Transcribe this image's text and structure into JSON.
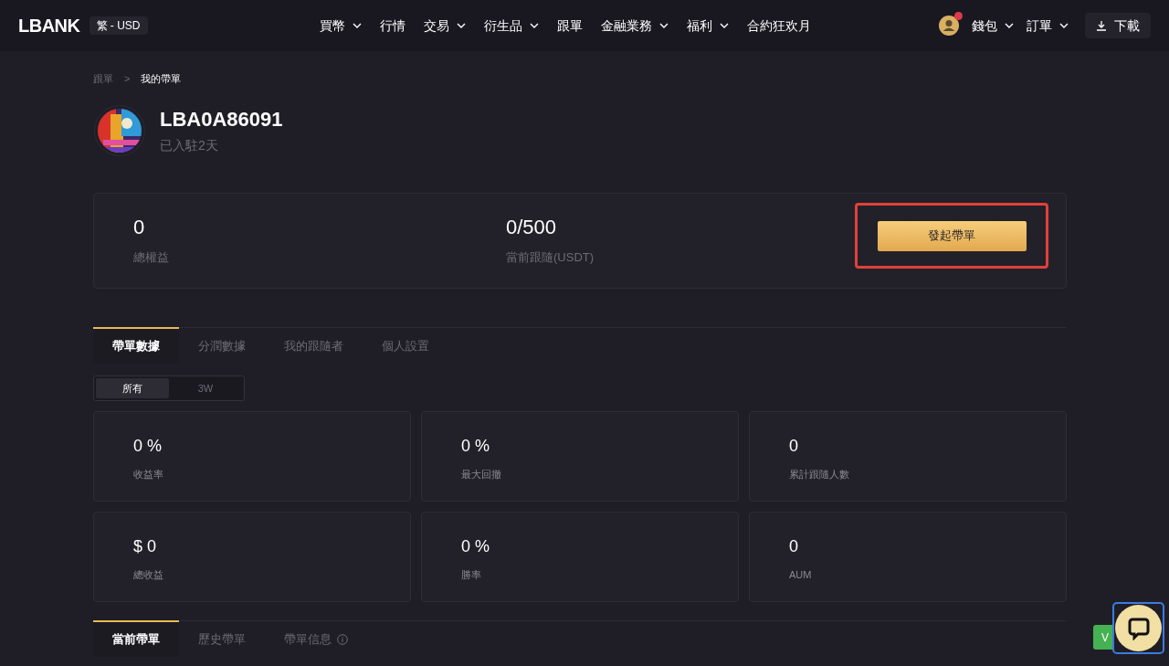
{
  "header": {
    "logo": "LBANK",
    "locale": "繁 - USD",
    "nav": [
      {
        "label": "買幣",
        "dropdown": true
      },
      {
        "label": "行情",
        "dropdown": false
      },
      {
        "label": "交易",
        "dropdown": true
      },
      {
        "label": "衍生品",
        "dropdown": true
      },
      {
        "label": "跟單",
        "dropdown": false
      },
      {
        "label": "金融業務",
        "dropdown": true
      },
      {
        "label": "福利",
        "dropdown": true
      },
      {
        "label": "合約狂欢月",
        "dropdown": false
      }
    ],
    "account": {
      "notification": true,
      "menus": [
        {
          "label": "錢包"
        },
        {
          "label": "訂單"
        }
      ],
      "download": "下載"
    }
  },
  "breadcrumb": [
    {
      "label": "跟單",
      "selected": false
    },
    {
      "label": "我的帶單",
      "selected": true
    }
  ],
  "breadcrumb_separator": ">",
  "profile": {
    "name": "LBA0A86091",
    "joined": "已入駐2天"
  },
  "summary": {
    "stats": [
      {
        "value": "0",
        "label": "總權益"
      },
      {
        "value": "0/500",
        "label": "當前跟隨(USDT)"
      }
    ],
    "button": "發起帶單",
    "highlighted": true
  },
  "tabs": [
    {
      "label": "帶單數據",
      "selected": true
    },
    {
      "label": "分潤數據",
      "selected": false
    },
    {
      "label": "我的跟隨者",
      "selected": false
    },
    {
      "label": "個人設置",
      "selected": false
    }
  ],
  "period_filter": [
    {
      "label": "所有",
      "selected": true
    },
    {
      "label": "3W",
      "selected": false
    }
  ],
  "metrics": [
    {
      "value": "0 %",
      "label": "收益率"
    },
    {
      "value": "0 %",
      "label": "最大回撤"
    },
    {
      "value": "0",
      "label": "累計跟隨人數"
    },
    {
      "value": "$ 0",
      "label": "總收益"
    },
    {
      "value": "0 %",
      "label": "勝率"
    },
    {
      "value": "0",
      "label": "AUM"
    }
  ],
  "order_tabs": [
    {
      "label": "當前帶單",
      "selected": true,
      "info": false
    },
    {
      "label": "歷史帶單",
      "selected": false,
      "info": false
    },
    {
      "label": "帶單信息",
      "selected": false,
      "info": true
    }
  ],
  "floating": {
    "partial_button": "V"
  }
}
